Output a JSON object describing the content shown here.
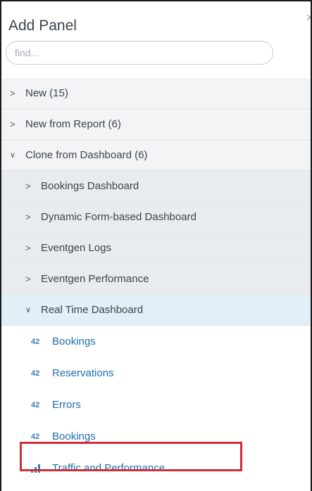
{
  "panel": {
    "title": "Add Panel",
    "close_glyph": "×",
    "search_placeholder": "find..."
  },
  "tree": {
    "new": "New (15)",
    "new_from_report": "New from Report (6)",
    "clone_from_dashboard": "Clone from Dashboard (6)",
    "dashboards": [
      "Bookings Dashboard",
      "Dynamic Form-based Dashboard",
      "Eventgen Logs",
      "Eventgen Performance",
      "Real Time Dashboard"
    ],
    "panels": [
      {
        "icon": "single-value-icon",
        "badge": "42",
        "label": "Bookings"
      },
      {
        "icon": "single-value-icon",
        "badge": "42",
        "label": "Reservations"
      },
      {
        "icon": "single-value-icon",
        "badge": "42",
        "label": "Errors"
      },
      {
        "icon": "single-value-icon",
        "badge": "42",
        "label": "Bookings"
      },
      {
        "icon": "bar-chart-icon",
        "label": "Traffic and Performance"
      }
    ]
  },
  "colors": {
    "highlight_border": "#d12c3a",
    "link": "#1e6fa8",
    "expanded_row": "#e1eff6"
  }
}
